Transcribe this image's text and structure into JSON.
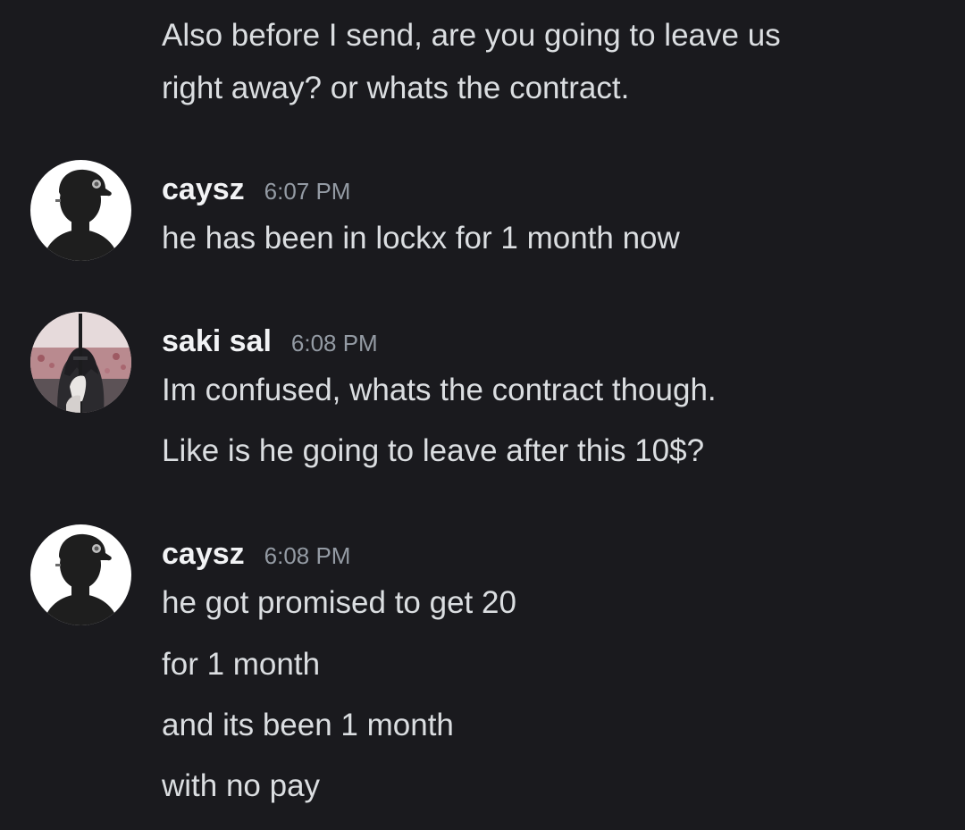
{
  "messages": [
    {
      "continuation": true,
      "lines": [
        "Also before I send, are you going to leave us",
        "right away? or whats the contract."
      ]
    },
    {
      "author": "caysz",
      "timestamp": "6:07 PM",
      "avatar_icon": "silhouette-cap-avatar-icon",
      "lines": [
        "he has been in lockx for 1 month now"
      ]
    },
    {
      "author": "saki sal",
      "timestamp": "6:08 PM",
      "avatar_icon": "anime-swordsman-avatar-icon",
      "lines": [
        "Im confused, whats the contract though.",
        "Like is he going to leave after this 10$?"
      ]
    },
    {
      "author": "caysz",
      "timestamp": "6:08 PM",
      "avatar_icon": "silhouette-cap-avatar-icon",
      "lines": [
        "he got promised to get 20",
        "for 1 month",
        "and its been 1 month",
        "with no pay"
      ]
    }
  ],
  "colors": {
    "background": "#1a1a1e",
    "message_text": "#dbdee1",
    "username": "#f2f3f5",
    "timestamp": "#949ba4"
  }
}
